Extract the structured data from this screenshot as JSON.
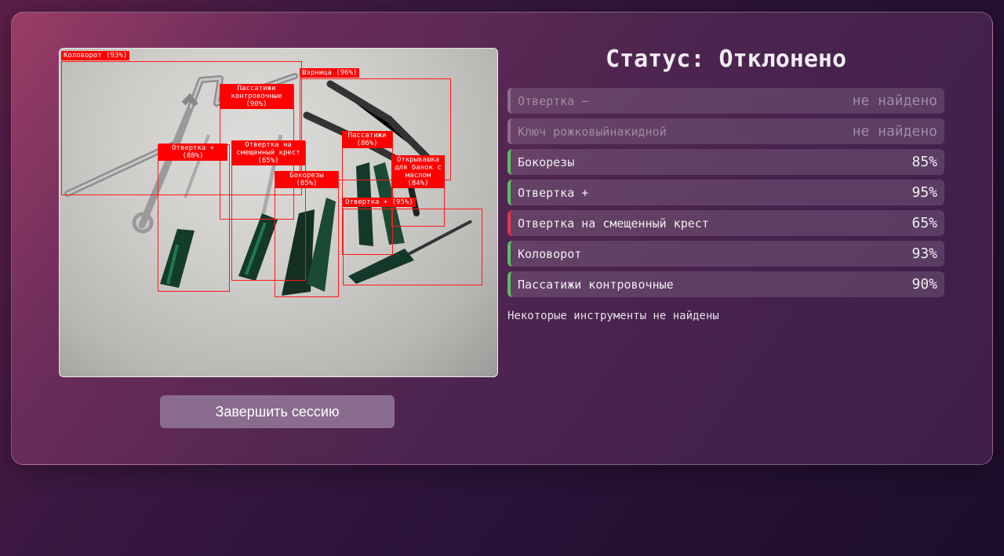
{
  "status": {
    "title": "Статус: Отклонено"
  },
  "tools": [
    {
      "name": "Отвертка −",
      "value": "не найдено",
      "state": "missing"
    },
    {
      "name": "Ключ рожковыйнакидной",
      "value": "не найдено",
      "state": "missing"
    },
    {
      "name": "Бокорезы",
      "value": "85%",
      "state": "ok"
    },
    {
      "name": "Отвертка +",
      "value": "95%",
      "state": "ok"
    },
    {
      "name": "Отвертка на смещенный крест",
      "value": "65%",
      "state": "fail"
    },
    {
      "name": "Коловорот",
      "value": "93%",
      "state": "ok"
    },
    {
      "name": "Пассатижи контровочные",
      "value": "90%",
      "state": "ok"
    }
  ],
  "note": "Некоторые инструменты не найдены",
  "finish_button": "Завершить сессию",
  "detections": [
    {
      "label": "Коловорот (93%)"
    },
    {
      "label": "Шэрница (96%)"
    },
    {
      "label": "Пассатижи\nконтровочные\n(90%)"
    },
    {
      "label": "Отвертка +\n(88%)"
    },
    {
      "label": "Отвертка на\nсмещенный крест\n(65%)"
    },
    {
      "label": "Пассатижи\n(86%)"
    },
    {
      "label": "Открывашка\nдля банок с\nмаслом\n(84%)"
    },
    {
      "label": "Бокорезы\n(85%)"
    },
    {
      "label": "Отвертка + (95%)"
    }
  ],
  "colors": {
    "ok": "#5bbf5e",
    "fail": "#e6334d",
    "missing": "#8c6f8e",
    "box": "#ff0000"
  }
}
